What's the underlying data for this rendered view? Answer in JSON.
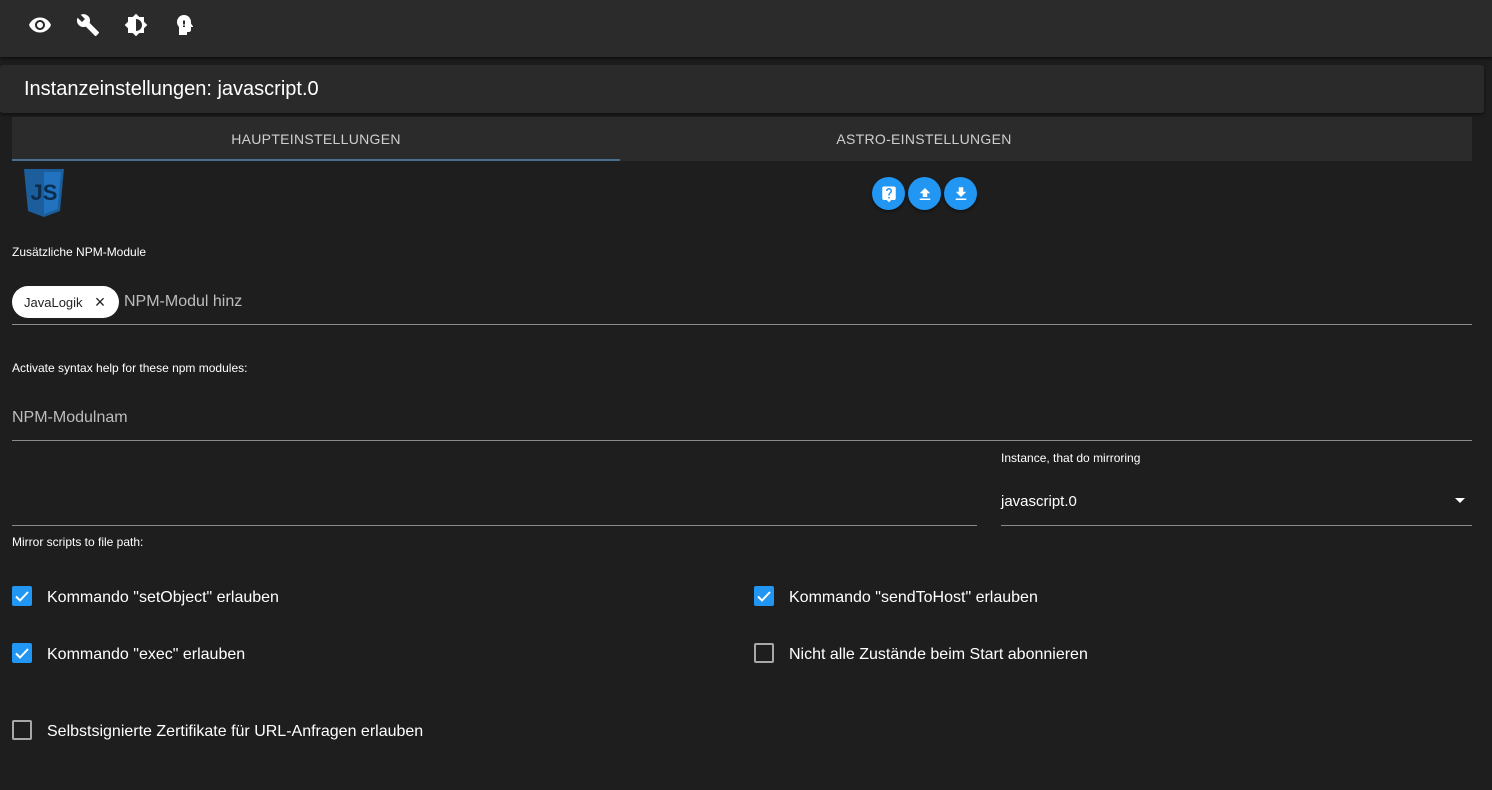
{
  "topbar": {
    "icons": [
      "eye-icon",
      "wrench-icon",
      "brightness-icon",
      "expert-mode-icon"
    ]
  },
  "dialog": {
    "title": "Instanzeinstellungen: javascript.0"
  },
  "tabs": [
    {
      "label": "HAUPTEINSTELLUNGEN",
      "active": true
    },
    {
      "label": "ASTRO-EINSTELLUNGEN",
      "active": false
    }
  ],
  "logo": {
    "text": "JS"
  },
  "actions": [
    "help-icon",
    "upload-icon",
    "download-icon"
  ],
  "npm_modules": {
    "label": "Zusätzliche NPM-Module",
    "chips": [
      {
        "label": "JavaLogik"
      }
    ],
    "placeholder": "NPM-Modul hinz"
  },
  "syntax_help": {
    "label": "Activate syntax help for these npm modules:",
    "placeholder": "NPM-Modulnam"
  },
  "mirror": {
    "path_label": "Mirror scripts to file path:",
    "path_value": "",
    "instance_label": "Instance, that do mirroring",
    "instance_value": "javascript.0"
  },
  "checkboxes": [
    {
      "label": "Kommando \"setObject\" erlauben",
      "checked": true
    },
    {
      "label": "Kommando \"sendToHost\" erlauben",
      "checked": true
    },
    {
      "label": "Kommando \"exec\" erlauben",
      "checked": true
    },
    {
      "label": "Nicht alle Zustände beim Start abonnieren",
      "checked": false
    },
    {
      "label": "Selbstsignierte Zertifikate für URL-Anfragen erlauben",
      "checked": false
    }
  ],
  "colors": {
    "accent": "#2196f3",
    "background": "#1e1e1e",
    "bar": "#2b2b2b"
  }
}
